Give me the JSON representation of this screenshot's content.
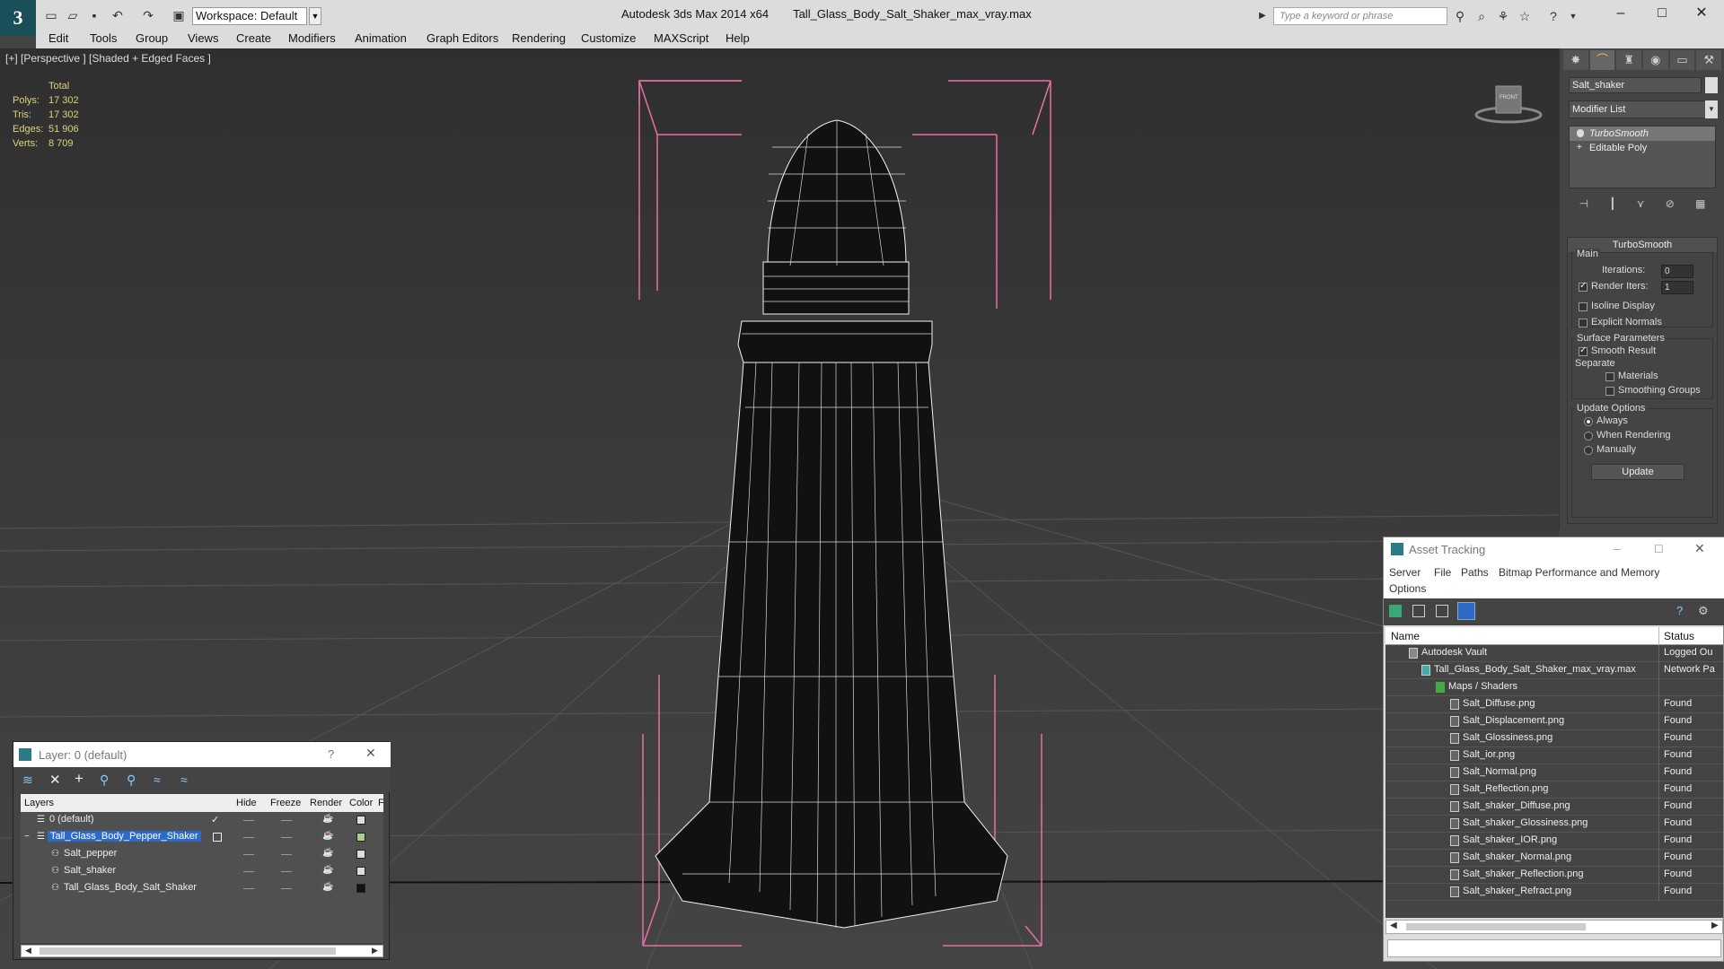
{
  "window": {
    "app_title": "Autodesk 3ds Max  2014 x64",
    "file_title": "Tall_Glass_Body_Salt_Shaker_max_vray.max",
    "workspace": "Workspace: Default",
    "search_placeholder": "Type a keyword or phrase"
  },
  "menu": [
    "Edit",
    "Tools",
    "Group",
    "Views",
    "Create",
    "Modifiers",
    "Animation",
    "Graph Editors",
    "Rendering",
    "Customize",
    "MAXScript",
    "Help"
  ],
  "viewport": {
    "label": "[+] [Perspective ] [Shaded + Edged Faces ]",
    "stats_header": "Total",
    "stats": [
      {
        "key": "Polys:",
        "value": "17 302"
      },
      {
        "key": "Tris:",
        "value": "17 302"
      },
      {
        "key": "Edges:",
        "value": "51 906"
      },
      {
        "key": "Verts:",
        "value": "8 709"
      }
    ],
    "viewcube_label": "FRONT"
  },
  "command_panel": {
    "object_name": "Salt_shaker",
    "modifier_list": "Modifier List",
    "stack": [
      "TurboSmooth",
      "Editable Poly"
    ],
    "rollout_title": "TurboSmooth",
    "main_label": "Main",
    "iterations_label": "Iterations:",
    "iterations_value": "0",
    "render_iters_label": "Render Iters:",
    "render_iters_value": "1",
    "isoline_label": "Isoline Display",
    "explicit_normals_label": "Explicit Normals",
    "surface_params_label": "Surface Parameters",
    "smooth_result_label": "Smooth Result",
    "separate_label": "Separate",
    "materials_label": "Materials",
    "smoothing_groups_label": "Smoothing Groups",
    "update_options_label": "Update Options",
    "always_label": "Always",
    "when_rendering_label": "When Rendering",
    "manually_label": "Manually",
    "update_button": "Update"
  },
  "asset_tracking": {
    "title": "Asset Tracking",
    "menu": [
      "Server",
      "File",
      "Paths",
      "Bitmap Performance and Memory",
      "Options"
    ],
    "col_name": "Name",
    "col_status": "Status",
    "rows": [
      {
        "name": "Autodesk Vault",
        "status": "Logged Ou"
      },
      {
        "name": "Tall_Glass_Body_Salt_Shaker_max_vray.max",
        "status": "Network Pa"
      },
      {
        "name": "Maps / Shaders",
        "status": ""
      },
      {
        "name": "Salt_Diffuse.png",
        "status": "Found"
      },
      {
        "name": "Salt_Displacement.png",
        "status": "Found"
      },
      {
        "name": "Salt_Glossiness.png",
        "status": "Found"
      },
      {
        "name": "Salt_ior.png",
        "status": "Found"
      },
      {
        "name": "Salt_Normal.png",
        "status": "Found"
      },
      {
        "name": "Salt_Reflection.png",
        "status": "Found"
      },
      {
        "name": "Salt_shaker_Diffuse.png",
        "status": "Found"
      },
      {
        "name": "Salt_shaker_Glossiness.png",
        "status": "Found"
      },
      {
        "name": "Salt_shaker_IOR.png",
        "status": "Found"
      },
      {
        "name": "Salt_shaker_Normal.png",
        "status": "Found"
      },
      {
        "name": "Salt_shaker_Reflection.png",
        "status": "Found"
      },
      {
        "name": "Salt_shaker_Refract.png",
        "status": "Found"
      }
    ]
  },
  "layer_manager": {
    "title": "Layer: 0 (default)",
    "help": "?",
    "col_layers": "Layers",
    "col_hide": "Hide",
    "col_freeze": "Freeze",
    "col_render": "Render",
    "col_color": "Color",
    "col_extra": "F",
    "rows": [
      {
        "name": "0 (default)",
        "color": "#dddddd"
      },
      {
        "name": "Tall_Glass_Body_Pepper_Shaker",
        "color": "#a8d08d"
      },
      {
        "name": "Salt_pepper",
        "color": "#dddddd"
      },
      {
        "name": "Salt_shaker",
        "color": "#dddddd"
      },
      {
        "name": "Tall_Glass_Body_Salt_Shaker",
        "color": "#111111"
      }
    ]
  }
}
